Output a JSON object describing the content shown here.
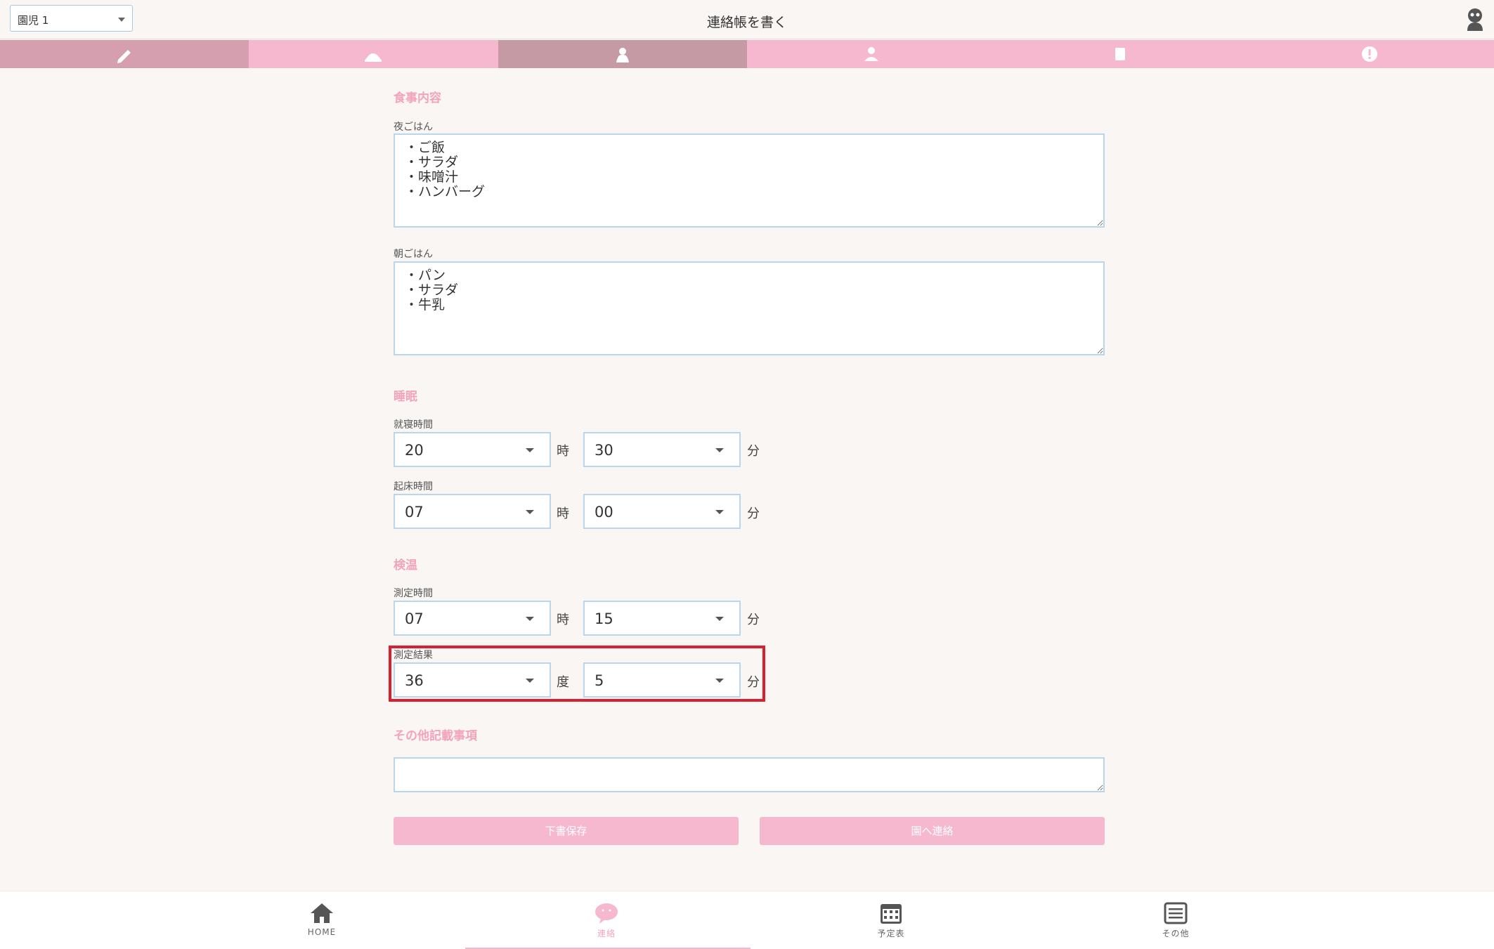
{
  "header": {
    "child_select": "園児 1",
    "title": "連絡帳を書く"
  },
  "tabs": [
    {
      "icon": "pencil-icon"
    },
    {
      "icon": "meal-icon"
    },
    {
      "icon": "sleep-icon"
    },
    {
      "icon": "bath-icon"
    },
    {
      "icon": "toilet-icon"
    },
    {
      "icon": "alert-icon"
    }
  ],
  "meal": {
    "section_title": "食事内容",
    "dinner_label": "夜ごはん",
    "dinner_value": "・ご飯\n・サラダ\n・味噌汁\n・ハンバーグ",
    "breakfast_label": "朝ごはん",
    "breakfast_value": "・パン\n・サラダ\n・牛乳"
  },
  "sleep": {
    "section_title": "睡眠",
    "bedtime_label": "就寝時間",
    "bedtime_hour": "20",
    "bedtime_minute": "30",
    "wake_label": "起床時間",
    "wake_hour": "07",
    "wake_minute": "00",
    "hour_unit": "時",
    "minute_unit": "分"
  },
  "temperature": {
    "section_title": "検温",
    "time_label": "測定時間",
    "time_hour": "07",
    "time_minute": "15",
    "result_label": "測定結果",
    "result_degree": "36",
    "result_decimal": "5",
    "degree_unit": "度",
    "decimal_unit": "分",
    "hour_unit": "時",
    "minute_unit": "分"
  },
  "notes": {
    "section_title": "その他記載事項",
    "value": ""
  },
  "buttons": {
    "save_draft": "下書保存",
    "send": "園へ連絡"
  },
  "bottom_nav": {
    "home": "HOME",
    "contact": "連絡",
    "schedule": "予定表",
    "other": "その他"
  },
  "colors": {
    "accent_pink": "#f5b8ce",
    "section_title": "#f4a3be",
    "highlight_red": "#d92030",
    "input_border": "#b9d6ec"
  }
}
